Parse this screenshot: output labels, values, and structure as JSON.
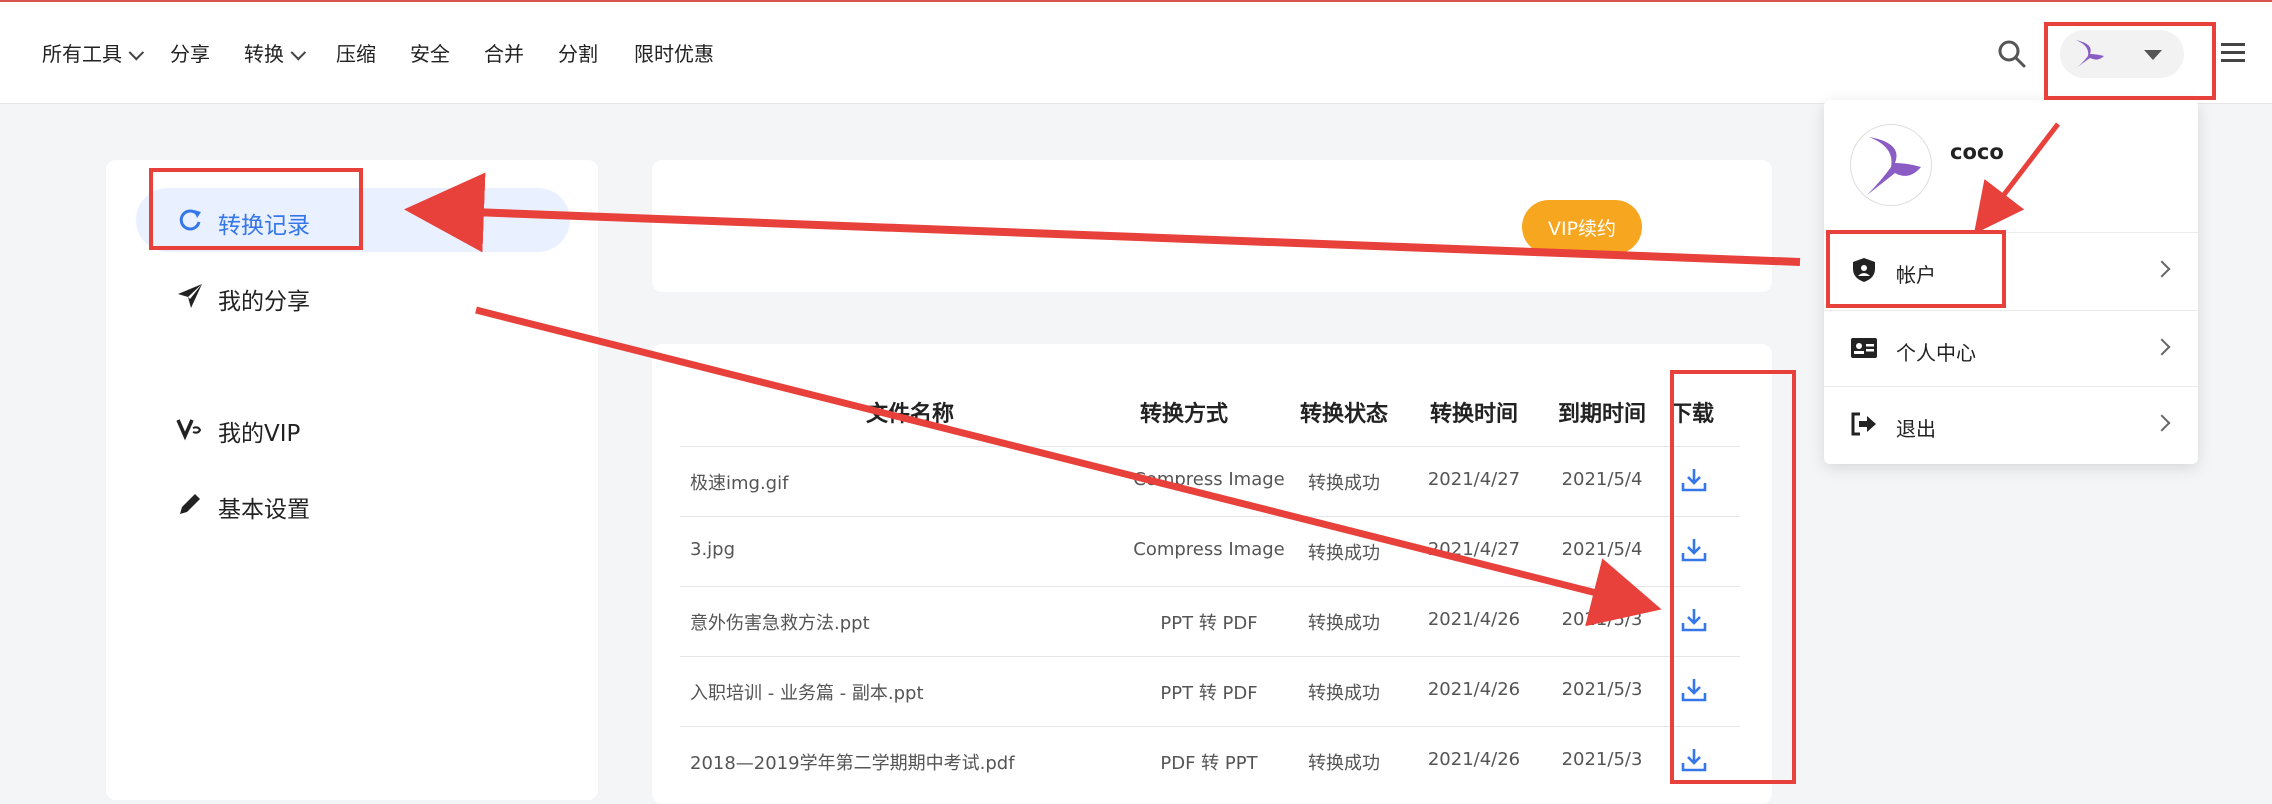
{
  "nav": {
    "items": [
      "所有工具",
      "分享",
      "转换",
      "压缩",
      "安全",
      "合并",
      "分割",
      "限时优惠"
    ],
    "has_dropdown": [
      true,
      false,
      true,
      false,
      false,
      false,
      false,
      false
    ]
  },
  "sidebar": {
    "items": [
      {
        "label": "转换记录",
        "icon": "refresh-icon",
        "active": true
      },
      {
        "label": "我的分享",
        "icon": "send-icon",
        "active": false
      },
      {
        "label": "我的VIP",
        "icon": "vip-icon",
        "active": false
      },
      {
        "label": "基本设置",
        "icon": "pencil-icon",
        "active": false
      }
    ]
  },
  "vip_renew_label": "VIP续约",
  "table": {
    "headers": [
      "文件名称",
      "转换方式",
      "转换状态",
      "转换时间",
      "到期时间",
      "下载"
    ],
    "rows": [
      {
        "name": "极速img.gif",
        "method": "Compress Image",
        "status": "转换成功",
        "time": "2021/4/27",
        "expiry": "2021/5/4"
      },
      {
        "name": "3.jpg",
        "method": "Compress Image",
        "status": "转换成功",
        "time": "2021/4/27",
        "expiry": "2021/5/4"
      },
      {
        "name": "意外伤害急救方法.ppt",
        "method": "PPT 转 PDF",
        "status": "转换成功",
        "time": "2021/4/26",
        "expiry": "2021/5/3"
      },
      {
        "name": "入职培训 - 业务篇 - 副本.ppt",
        "method": "PPT 转 PDF",
        "status": "转换成功",
        "time": "2021/4/26",
        "expiry": "2021/5/3"
      },
      {
        "name": "2018—2019学年第二学期期中考试.pdf",
        "method": "PDF 转 PPT",
        "status": "转换成功",
        "time": "2021/4/26",
        "expiry": "2021/5/3"
      }
    ]
  },
  "account_menu": {
    "username": "coco",
    "items": [
      {
        "label": "帐户",
        "icon": "shield-icon"
      },
      {
        "label": "个人中心",
        "icon": "id-card-icon"
      },
      {
        "label": "退出",
        "icon": "logout-icon"
      }
    ]
  },
  "colors": {
    "accent": "#3576e8",
    "vip": "#f7a620",
    "annotation": "#e8403a",
    "avatar_purple": "#8a5cc4"
  }
}
